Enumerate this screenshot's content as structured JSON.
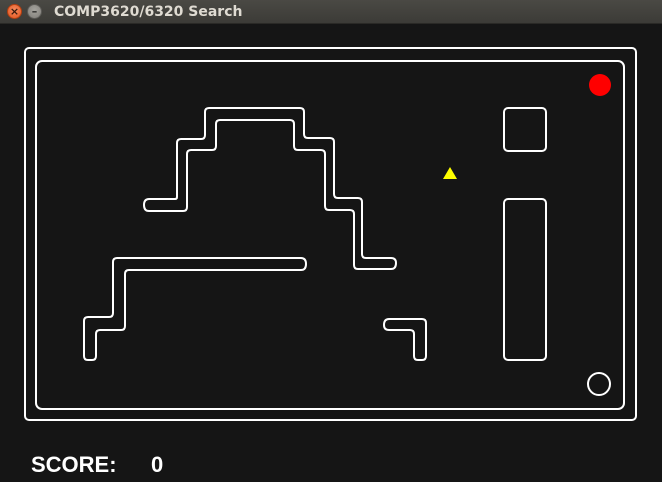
{
  "window": {
    "title": "COMP3620/6320 Search",
    "close_glyph": "×",
    "minimize_glyph": "–"
  },
  "game": {
    "score_label": "SCORE:",
    "score_value": "0",
    "colors": {
      "background": "#151515",
      "walls": "#ffffff",
      "pacman": "#ffff00",
      "food": "#ff0000",
      "ghost_outline": "#ffffff"
    },
    "agent": {
      "type": "triangle-icon",
      "color": "#ffff00"
    },
    "food": {
      "type": "red-dot",
      "color": "#ff0000"
    },
    "goal": {
      "type": "hollow-circle"
    }
  }
}
